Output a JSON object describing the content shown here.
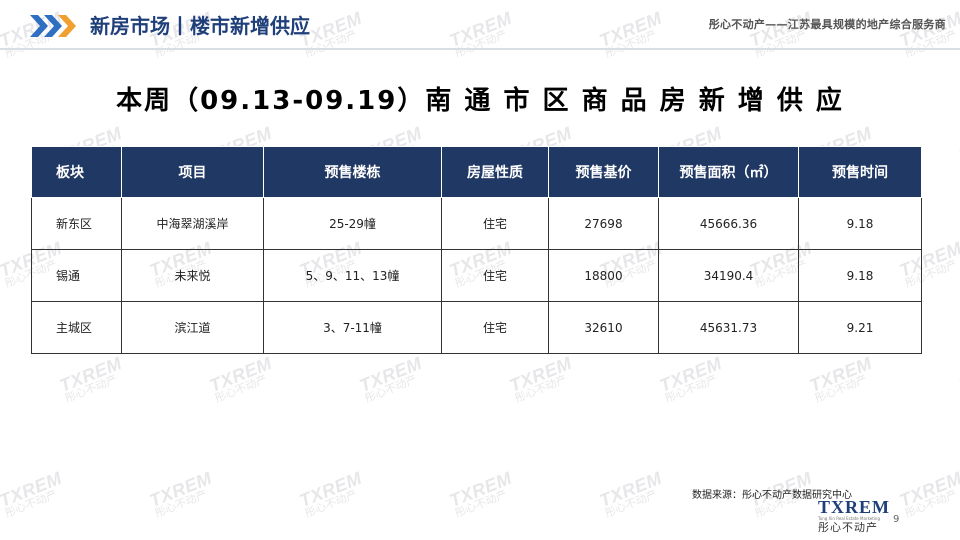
{
  "header": {
    "section_title": "新房市场丨楼市新增供应",
    "tagline": "彤心不动产——江苏最具规模的地产综合服务商"
  },
  "page_title": "本周（09.13-09.19）南 通 市 区 商 品 房 新 增 供 应",
  "table": {
    "columns": [
      "板块",
      "项目",
      "预售楼栋",
      "房屋性质",
      "预售基价",
      "预售面积（㎡）",
      "预售时间"
    ],
    "rows": [
      [
        "新东区",
        "中海翠湖溪岸",
        "25-29幢",
        "住宅",
        "27698",
        "45666.36",
        "9.18"
      ],
      [
        "锡通",
        "未来悦",
        "5、9、11、13幢",
        "住宅",
        "18800",
        "34190.4",
        "9.18"
      ],
      [
        "主城区",
        "滨江道",
        "3、7-11幢",
        "住宅",
        "32610",
        "45631.73",
        "9.21"
      ]
    ]
  },
  "footer": {
    "source": "数据来源：彤心不动产数据研究中心",
    "logo_text": "TXREM",
    "logo_subtext": "Tong Xin Real Estate Marketing",
    "logo_cn": "彤心不动产",
    "page_number": "9"
  },
  "watermark": {
    "brand": "TXREM",
    "cn": "彤心不动产"
  },
  "colors": {
    "accent": "#203864",
    "title_blue": "#1f3f7a",
    "chevron_blue": "#2e6fc2",
    "chevron_orange": "#f0a030"
  }
}
